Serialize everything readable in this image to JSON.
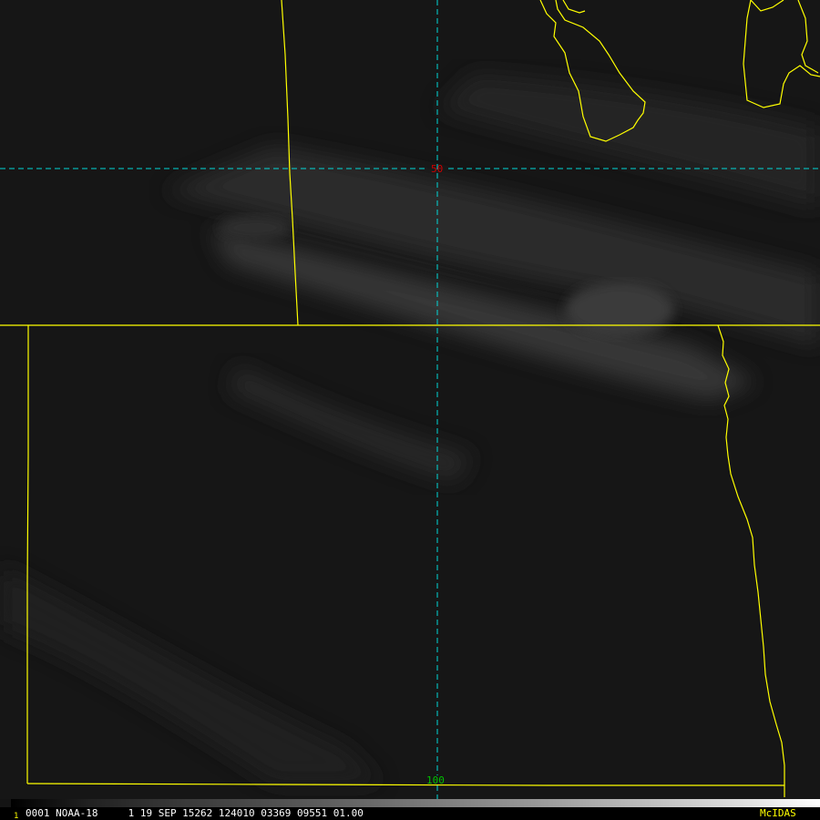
{
  "image": {
    "description_text": "",
    "colors": {
      "background": "#141414",
      "borders": "#ffff00",
      "gridlines": "#00d8d8",
      "lat_label": "#d00000",
      "lon_label": "#00c000",
      "status_text": "#ffffff",
      "brand": "#ffff00"
    }
  },
  "grid": {
    "latitude_label": "50",
    "longitude_label": "100"
  },
  "status_bar": {
    "frame_number": "1",
    "text": "0001 NOAA-18     1 19 SEP 15262 124010 03369 09551 01.00",
    "brand": "McIDAS"
  },
  "icons": {
    "grayscale": "grayscale-bar-icon"
  }
}
